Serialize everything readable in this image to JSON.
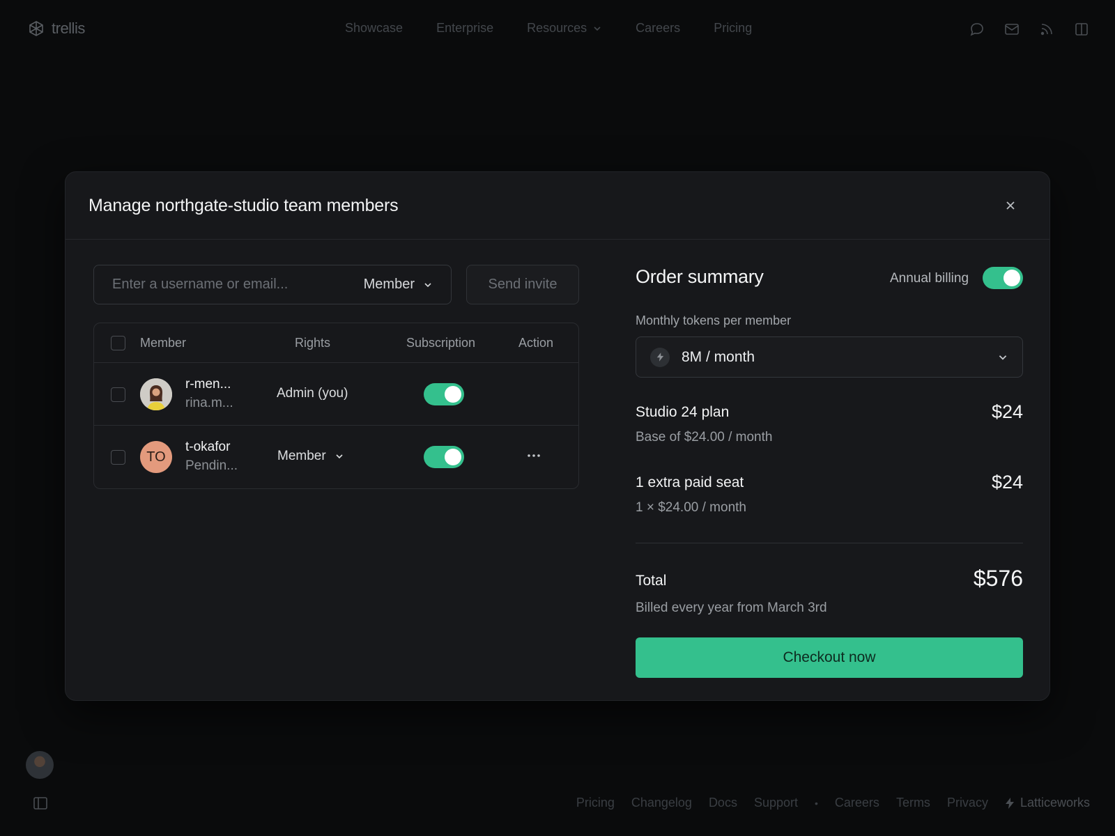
{
  "nav": {
    "brand": "trellis",
    "links": [
      "Showcase",
      "Enterprise",
      "Resources",
      "Careers",
      "Pricing"
    ]
  },
  "modal": {
    "title": "Manage northgate-studio team members",
    "invite": {
      "placeholder": "Enter a username or email...",
      "role": "Member",
      "send_label": "Send invite"
    },
    "table": {
      "headers": {
        "member": "Member",
        "rights": "Rights",
        "subscription": "Subscription",
        "action": "Action"
      },
      "rows": [
        {
          "name": "r-men...",
          "sub": "rina.m...",
          "rights": "Admin (you)",
          "subscription_on": true
        },
        {
          "initials": "TO",
          "name": "t-okafor",
          "sub": "Pendin...",
          "rights": "Member",
          "subscription_on": true
        }
      ]
    },
    "order": {
      "title": "Order summary",
      "annual_label": "Annual billing",
      "annual_on": true,
      "tokens_label": "Monthly tokens per member",
      "tokens_value": "8M / month",
      "plan": {
        "title": "Studio 24 plan",
        "sub": "Base of $24.00 / month",
        "price": "$24"
      },
      "seat": {
        "title": "1 extra paid seat",
        "sub": "1 × $24.00 / month",
        "price": "$24"
      },
      "total": {
        "title": "Total",
        "sub": "Billed every year from March 3rd",
        "price": "$576"
      },
      "checkout_label": "Checkout now"
    }
  },
  "footer": {
    "links": [
      "Pricing",
      "Changelog",
      "Docs",
      "Support",
      "Careers",
      "Terms",
      "Privacy"
    ],
    "separator": "•",
    "brand": "Latticeworks"
  },
  "colors": {
    "accent": "#34c08d",
    "modal_bg": "#17181b",
    "page_bg": "#0a0b0c"
  }
}
